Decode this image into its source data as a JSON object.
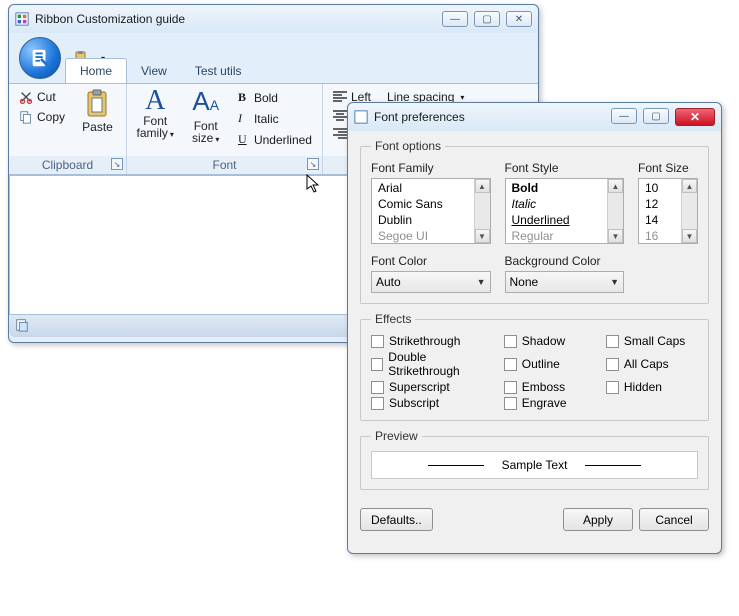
{
  "main": {
    "title": "Ribbon Customization guide",
    "tabs": [
      "Home",
      "View",
      "Test utils"
    ],
    "active_tab": 0,
    "clipboard": {
      "cut": "Cut",
      "copy": "Copy",
      "paste": "Paste",
      "group_label": "Clipboard"
    },
    "font_group": {
      "font_family": "Font\nfamily",
      "font_size": "Font\nsize",
      "bold": "Bold",
      "italic": "Italic",
      "underlined": "Underlined",
      "group_label": "Font"
    },
    "para_group": {
      "left": "Left",
      "line_spacing": "Line spacing"
    }
  },
  "dialog": {
    "title": "Font preferences",
    "options_legend": "Font options",
    "font_family_label": "Font Family",
    "font_families": [
      "Arial",
      "Comic Sans",
      "Dublin",
      "Segoe UI"
    ],
    "font_style_label": "Font Style",
    "font_styles": [
      "Bold",
      "Italic",
      "Underlined",
      "Regular"
    ],
    "font_size_label": "Font Size",
    "font_sizes": [
      "10",
      "12",
      "14",
      "16"
    ],
    "font_color_label": "Font Color",
    "font_color_value": "Auto",
    "bg_color_label": "Background Color",
    "bg_color_value": "None",
    "effects_legend": "Effects",
    "effects": {
      "strike": "Strikethrough",
      "dstrike": "Double Strikethrough",
      "sup": "Superscript",
      "sub": "Subscript",
      "shadow": "Shadow",
      "outline": "Outline",
      "emboss": "Emboss",
      "engrave": "Engrave",
      "smallcaps": "Small Caps",
      "allcaps": "All Caps",
      "hidden": "Hidden"
    },
    "preview_legend": "Preview",
    "preview_text": "Sample Text",
    "defaults": "Defaults..",
    "apply": "Apply",
    "cancel": "Cancel"
  }
}
